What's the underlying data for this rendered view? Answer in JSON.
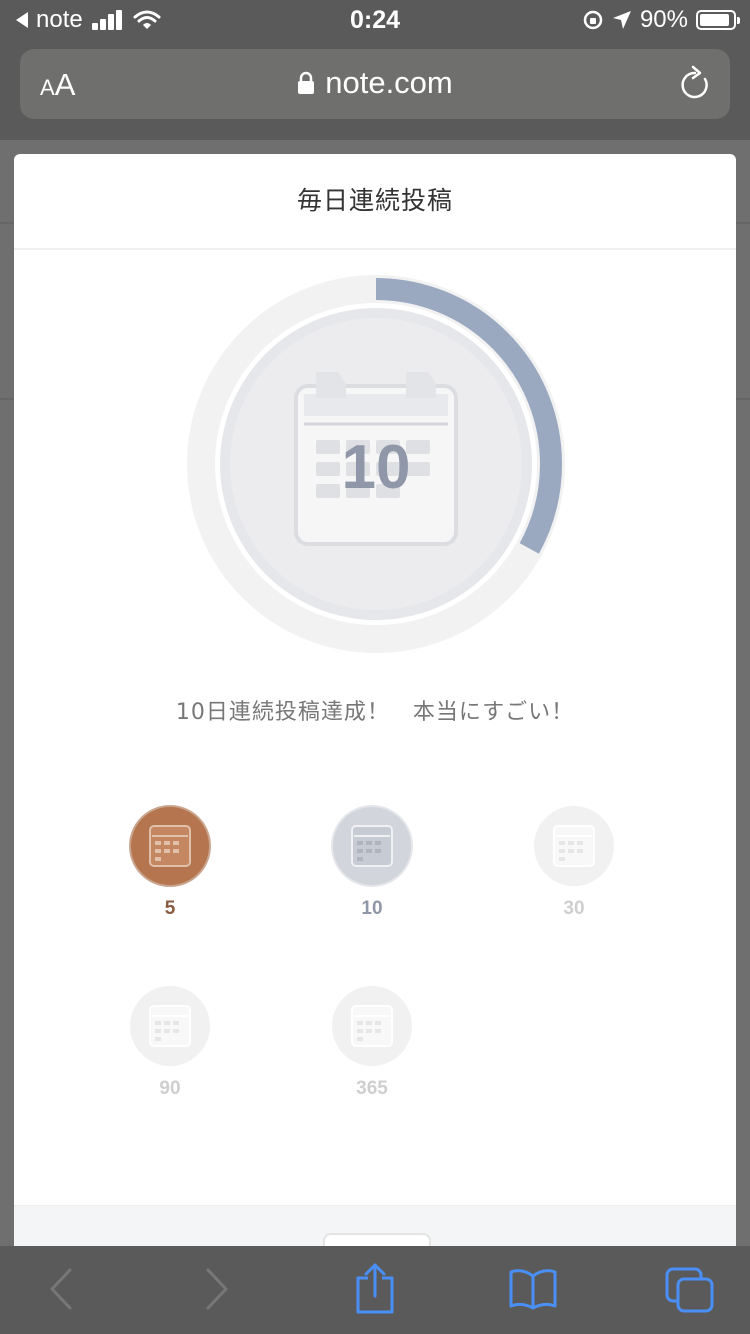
{
  "status_bar": {
    "back_app": "note",
    "time": "0:24",
    "battery_percent": "90%",
    "battery_level": 0.9
  },
  "browser": {
    "text_size_label_small": "A",
    "text_size_label_big": "A",
    "url": "note.com"
  },
  "modal": {
    "title": "毎日連続投稿",
    "current_streak": "10",
    "progress_fraction": 0.33,
    "message": "10日連続投稿達成！　本当にすごい！",
    "badges": [
      {
        "label": "5",
        "state": "achieved",
        "color": "#b06c4a"
      },
      {
        "label": "10",
        "state": "achieved",
        "color": "#8f97a8"
      },
      {
        "label": "30",
        "state": "locked",
        "color": "#d9d9d9"
      },
      {
        "label": "90",
        "state": "locked",
        "color": "#d9d9d9"
      },
      {
        "label": "365",
        "state": "locked",
        "color": "#d9d9d9"
      }
    ]
  },
  "colors": {
    "progress_accent": "#9aa9c0",
    "bronze": "#b5754f",
    "silver": "#c9ccd3",
    "locked": "#f1f1f1",
    "toolbar_icon": "#4a8ff5"
  },
  "toolbar": {
    "icons": [
      "back-icon",
      "forward-icon",
      "share-icon",
      "bookmarks-icon",
      "tabs-icon"
    ]
  }
}
